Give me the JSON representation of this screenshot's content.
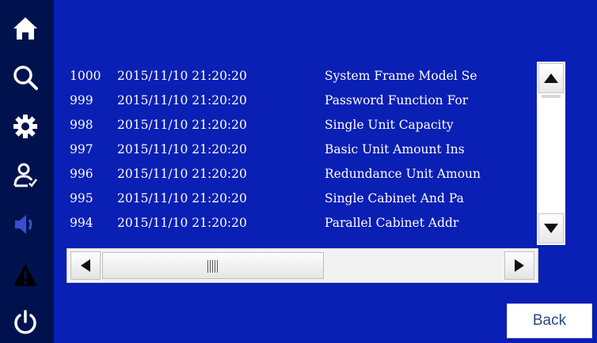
{
  "sidebar": {
    "items": [
      {
        "icon": "home-icon"
      },
      {
        "icon": "search-icon"
      },
      {
        "icon": "gear-icon"
      },
      {
        "icon": "user-check-icon"
      },
      {
        "icon": "speaker-icon"
      },
      {
        "icon": "warning-icon"
      },
      {
        "icon": "power-icon"
      }
    ]
  },
  "log": {
    "rows": [
      {
        "id": "1000",
        "datetime": "2015/11/10 21:20:20",
        "message": "System Frame Model Se"
      },
      {
        "id": "999",
        "datetime": "2015/11/10 21:20:20",
        "message": "Password Function For"
      },
      {
        "id": "998",
        "datetime": "2015/11/10 21:20:20",
        "message": "Single Unit Capacity "
      },
      {
        "id": "997",
        "datetime": "2015/11/10 21:20:20",
        "message": "Basic Unit Amount Ins"
      },
      {
        "id": "996",
        "datetime": "2015/11/10 21:20:20",
        "message": "Redundance Unit Amoun"
      },
      {
        "id": "995",
        "datetime": "2015/11/10 21:20:20",
        "message": "Single Cabinet And Pa"
      },
      {
        "id": "994",
        "datetime": "2015/11/10 21:20:20",
        "message": "Parallel Cabinet Addr"
      }
    ]
  },
  "back_label": "Back",
  "colors": {
    "background": "#0a1fb4",
    "sidebar": "#00124d",
    "text": "#ffffff"
  }
}
